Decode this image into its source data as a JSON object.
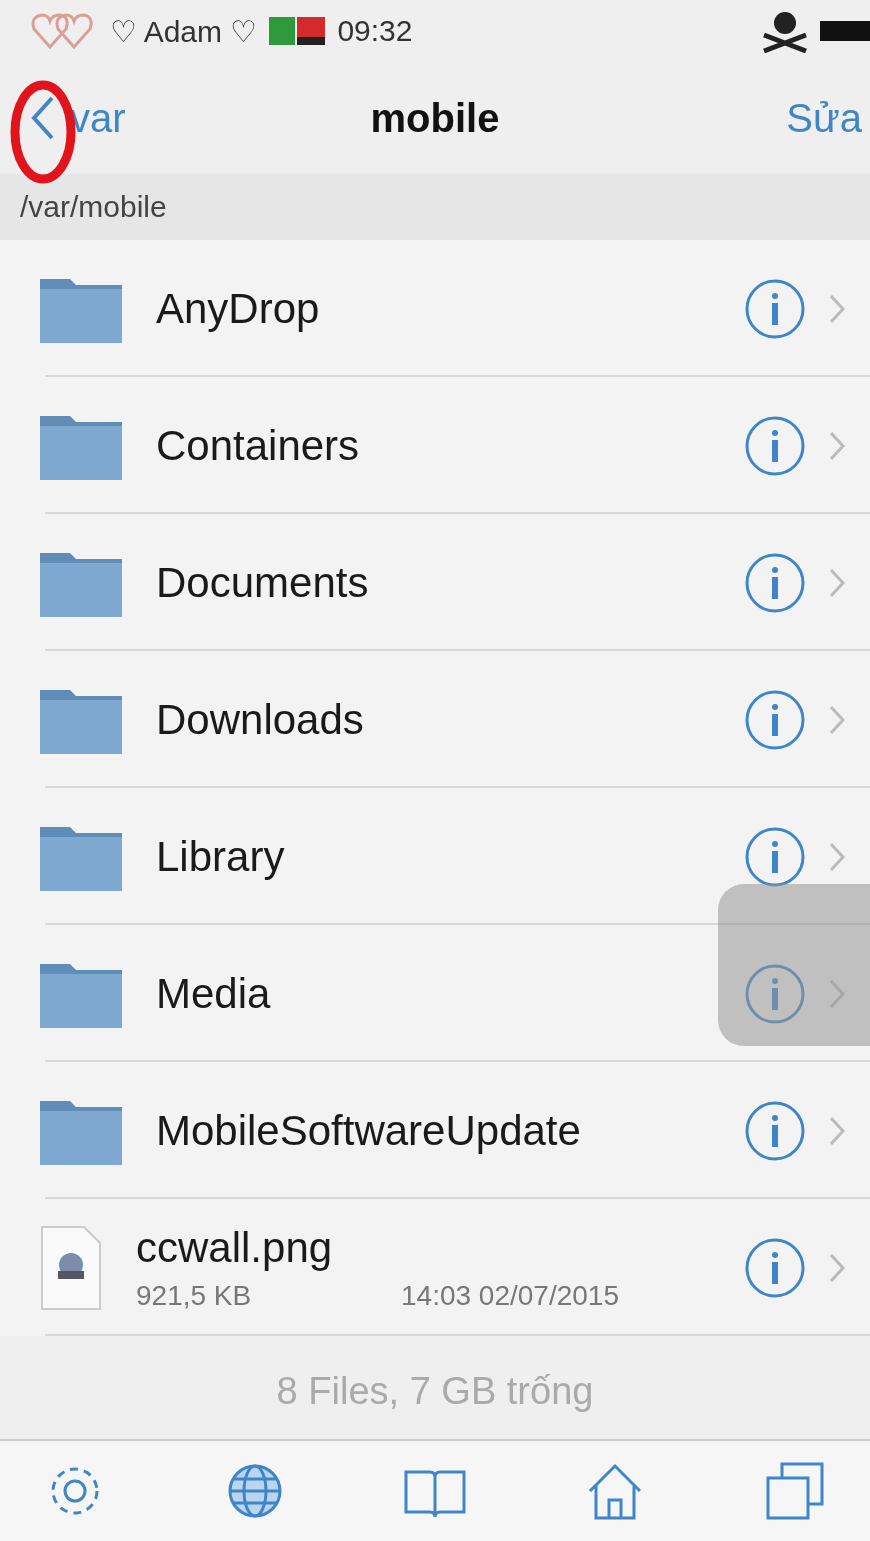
{
  "status_bar": {
    "carrier": "♡ Adam ♡",
    "time": "09:32"
  },
  "nav": {
    "back": "var",
    "title": "mobile",
    "edit": "Sửa"
  },
  "path": "/var/mobile",
  "items": [
    {
      "kind": "folder",
      "name": "AnyDrop"
    },
    {
      "kind": "folder",
      "name": "Containers"
    },
    {
      "kind": "folder",
      "name": "Documents"
    },
    {
      "kind": "folder",
      "name": "Downloads"
    },
    {
      "kind": "folder",
      "name": "Library"
    },
    {
      "kind": "folder",
      "name": "Media"
    },
    {
      "kind": "folder",
      "name": "MobileSoftwareUpdate"
    },
    {
      "kind": "file",
      "name": "ccwall.png",
      "size": "921,5 KB",
      "date": "14:03 02/07/2015"
    }
  ],
  "footer": "8 Files, 7 GB trống",
  "toolbar": [
    {
      "kind": "settings"
    },
    {
      "kind": "globe"
    },
    {
      "kind": "book"
    },
    {
      "kind": "home"
    },
    {
      "kind": "windows"
    }
  ]
}
